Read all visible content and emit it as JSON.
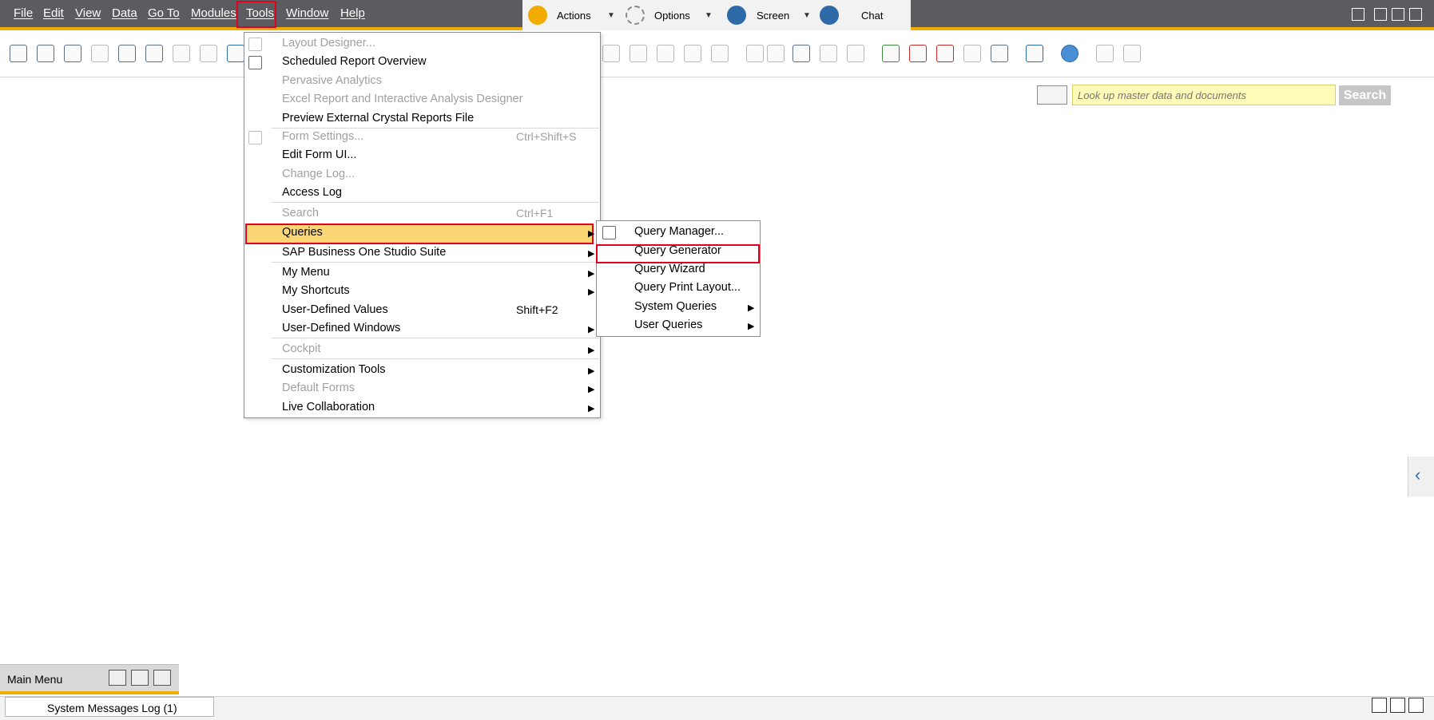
{
  "menubar": {
    "items": [
      "File",
      "Edit",
      "View",
      "Data",
      "Go To",
      "Modules",
      "Tools",
      "Window",
      "Help"
    ]
  },
  "top_toolbar": {
    "actions_label": "Actions",
    "options_label": "Options",
    "screen_label": "Screen",
    "chat_label": "Chat"
  },
  "search": {
    "placeholder": "Look up master data and documents",
    "button_label": "Search"
  },
  "tools_menu": {
    "items": [
      {
        "label": "Layout Designer...",
        "enabled": false
      },
      {
        "label": "Scheduled Report Overview",
        "enabled": true
      },
      {
        "label": "Pervasive Analytics",
        "enabled": false
      },
      {
        "label": "Excel Report and Interactive Analysis Designer",
        "enabled": false
      },
      {
        "label": "Preview External Crystal Reports File",
        "enabled": true
      },
      {
        "label": "Form Settings...",
        "enabled": false,
        "shortcut": "Ctrl+Shift+S"
      },
      {
        "label": "Edit Form UI...",
        "enabled": true
      },
      {
        "label": "Change Log...",
        "enabled": false
      },
      {
        "label": "Access Log",
        "enabled": true
      },
      {
        "label": "Search",
        "enabled": false,
        "shortcut": "Ctrl+F1"
      },
      {
        "label": "Queries",
        "enabled": true,
        "submenu": true,
        "highlighted": true
      },
      {
        "label": "SAP Business One Studio Suite",
        "enabled": true,
        "submenu": true
      },
      {
        "label": "My Menu",
        "enabled": true,
        "submenu": true
      },
      {
        "label": "My Shortcuts",
        "enabled": true,
        "submenu": true
      },
      {
        "label": "User-Defined Values",
        "enabled": true,
        "shortcut": "Shift+F2"
      },
      {
        "label": "User-Defined Windows",
        "enabled": true,
        "submenu": true
      },
      {
        "label": "Cockpit",
        "enabled": false,
        "submenu": true
      },
      {
        "label": "Customization Tools",
        "enabled": true,
        "submenu": true
      },
      {
        "label": "Default Forms",
        "enabled": false,
        "submenu": true
      },
      {
        "label": "Live Collaboration",
        "enabled": true,
        "submenu": true
      }
    ]
  },
  "queries_submenu": {
    "items": [
      {
        "label": "Query Manager..."
      },
      {
        "label": "Query Generator",
        "highlighted": true
      },
      {
        "label": "Query Wizard"
      },
      {
        "label": "Query Print Layout..."
      },
      {
        "label": "System Queries",
        "submenu": true
      },
      {
        "label": "User Queries",
        "submenu": true
      }
    ]
  },
  "main_menu": {
    "title": "Main Menu"
  },
  "statusbar": {
    "log_label": "System Messages Log (1)"
  },
  "colors": {
    "accent": "#f0ac00",
    "highlight_border": "#e3001b",
    "menu_highlight": "#fbd674",
    "menubar_bg": "#5b5b60"
  }
}
